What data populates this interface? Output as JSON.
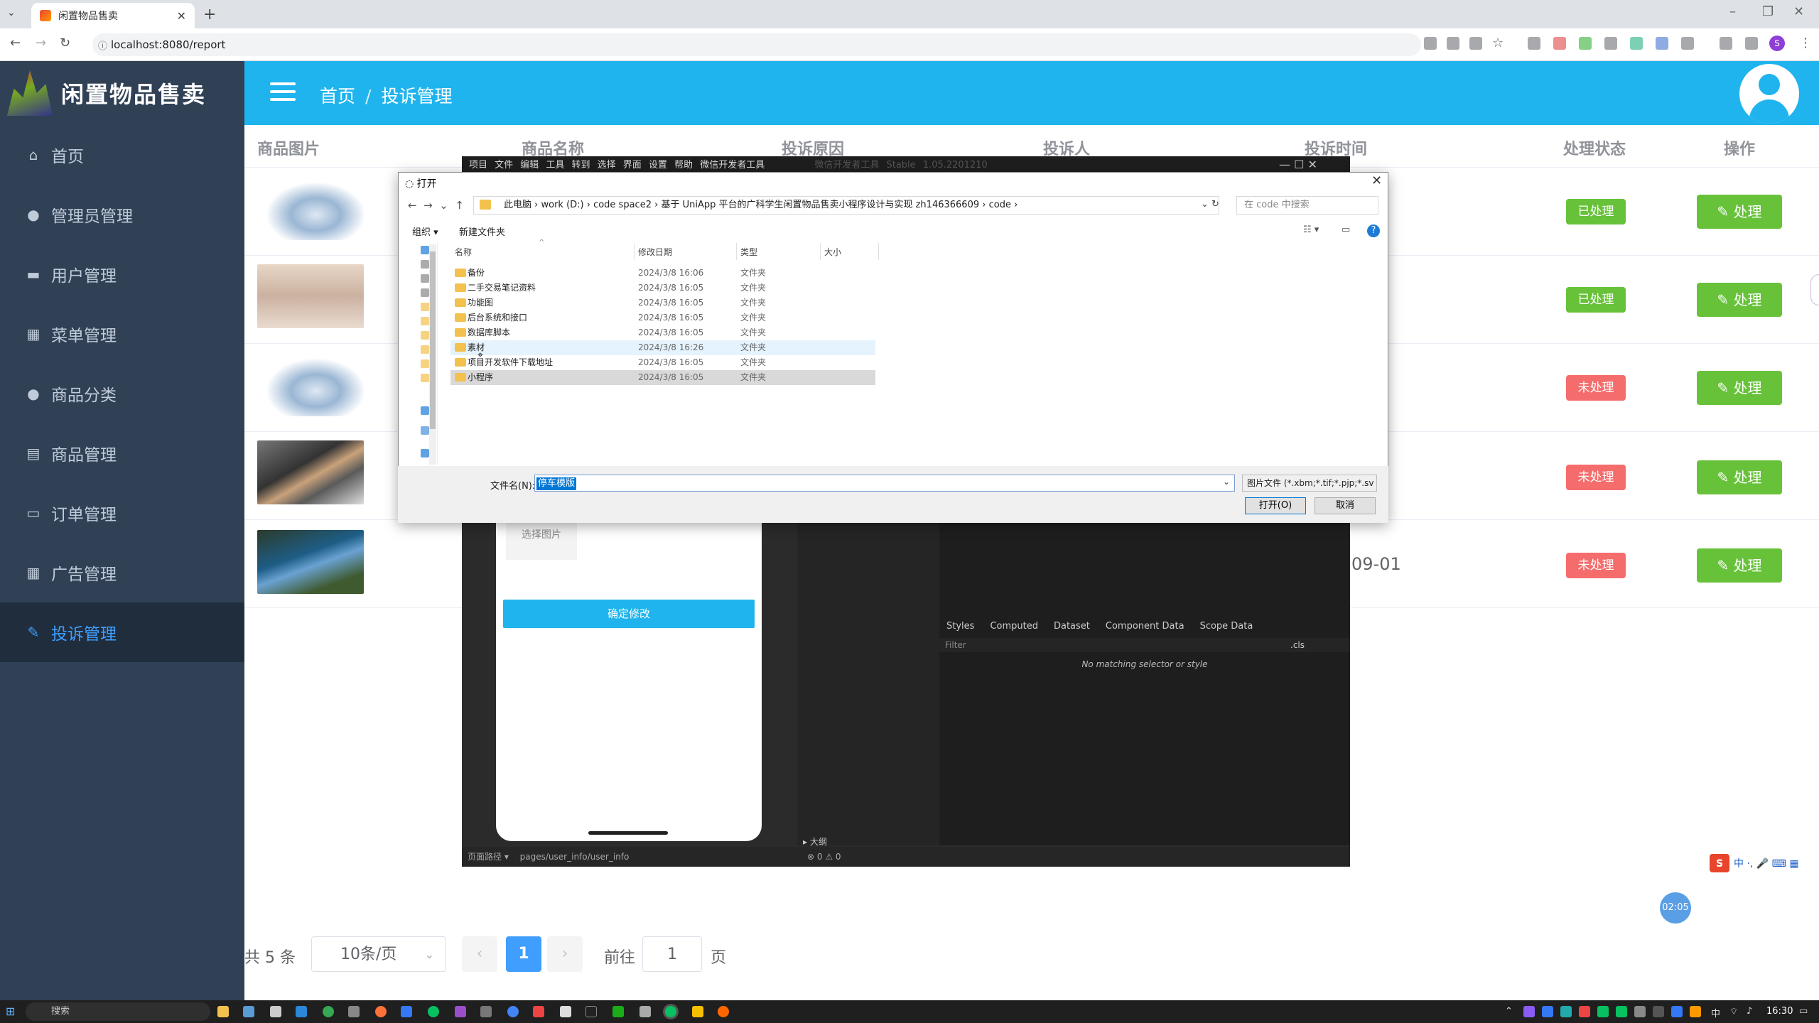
{
  "browser": {
    "tab_title": "闲置物品售卖",
    "url": "localhost:8080/report"
  },
  "app": {
    "logo_text": "闲置物品售卖",
    "breadcrumb": [
      "首页",
      "投诉管理"
    ]
  },
  "sidebar": {
    "items": [
      {
        "label": "首页",
        "icon": "home-icon"
      },
      {
        "label": "管理员管理",
        "icon": "user-icon"
      },
      {
        "label": "用户管理",
        "icon": "folder-icon"
      },
      {
        "label": "菜单管理",
        "icon": "grid-icon"
      },
      {
        "label": "商品分类",
        "icon": "user-icon"
      },
      {
        "label": "商品管理",
        "icon": "document-icon"
      },
      {
        "label": "订单管理",
        "icon": "monitor-icon"
      },
      {
        "label": "广告管理",
        "icon": "calendar-icon"
      },
      {
        "label": "投诉管理",
        "icon": "edit-icon"
      }
    ],
    "active_index": 8
  },
  "table": {
    "columns": [
      "商品图片",
      "商品名称",
      "投诉原因",
      "投诉人",
      "投诉时间",
      "处理状态",
      "操作"
    ],
    "rows": [
      {
        "image": "shoe",
        "status": "已处理",
        "status_color": "#67c23a",
        "action": "处理"
      },
      {
        "image": "girl",
        "status": "已处理",
        "status_color": "#67c23a",
        "action": "处理"
      },
      {
        "image": "shoe",
        "status": "未处理",
        "status_color": "#f56c6c",
        "action": "处理"
      },
      {
        "image": "phone",
        "status": "未处理",
        "status_color": "#f56c6c",
        "action": "处理"
      },
      {
        "image": "laptop",
        "status": "未处理",
        "status_color": "#f56c6c",
        "action": "处理",
        "time_partial": "09-01"
      }
    ]
  },
  "pagination": {
    "total": "共 5 条",
    "page_size": "10条/页",
    "current": "1",
    "goto_label": "前往",
    "goto_value": "1",
    "page_suffix": "页"
  },
  "ide": {
    "menu": "项目 文件 编辑 工具 转到 选择 界面 设置 帮助 微信开发者工具",
    "window_title": "微信开发者工具 Stable 1.05.2201210",
    "choose_image": "选择图片",
    "confirm_button": "确定修改",
    "devtools_tabs": [
      "Styles",
      "Computed",
      "Dataset",
      "Component Data",
      "Scope Data"
    ],
    "filter_placeholder": "Filter",
    "cls_label": ".cls",
    "no_match": "No matching selector or style",
    "outline_label": "▸ 大纲",
    "status_path_label": "页面路径 ▾",
    "status_path": "pages/user_info/user_info",
    "status_errors": "⊗ 0 ⚠ 0"
  },
  "dialog": {
    "title": "打开",
    "path": [
      "此电脑",
      "work (D:)",
      "code space2",
      "基于 UniApp 平台的广科学生闲置物品售卖小程序设计与实现 zh146366609",
      "code"
    ],
    "search_placeholder": "在 code 中搜索",
    "toolbar": {
      "organize": "组织 ▾",
      "new_folder": "新建文件夹"
    },
    "columns": [
      "名称",
      "修改日期",
      "类型",
      "大小"
    ],
    "files": [
      {
        "name": "备份",
        "date": "2024/3/8 16:06",
        "type": "文件夹"
      },
      {
        "name": "二手交易笔记资料",
        "date": "2024/3/8 16:05",
        "type": "文件夹"
      },
      {
        "name": "功能图",
        "date": "2024/3/8 16:05",
        "type": "文件夹"
      },
      {
        "name": "后台系统和接口",
        "date": "2024/3/8 16:05",
        "type": "文件夹"
      },
      {
        "name": "数据库脚本",
        "date": "2024/3/8 16:05",
        "type": "文件夹"
      },
      {
        "name": "素材",
        "date": "2024/3/8 16:26",
        "type": "文件夹"
      },
      {
        "name": "项目开发软件下载地址",
        "date": "2024/3/8 16:05",
        "type": "文件夹"
      },
      {
        "name": "小程序",
        "date": "2024/3/8 16:05",
        "type": "文件夹"
      }
    ],
    "filename_label": "文件名(N):",
    "filename_value": "停车模版",
    "filetype": "图片文件 (*.xbm;*.tif;*.pjp;*.sv",
    "open_button": "打开(O)",
    "cancel_button": "取消"
  },
  "overlay": {
    "timer": "02:05",
    "ime_text": "中 ·, 🎤 ⌨ ▦"
  },
  "taskbar": {
    "search": "搜索",
    "clock": "16:30",
    "tray_lang": "中"
  }
}
